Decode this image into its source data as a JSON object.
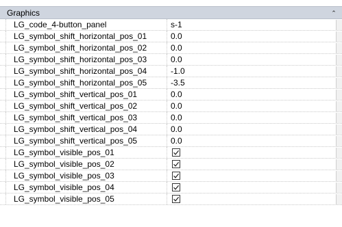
{
  "group": {
    "title": "Graphics",
    "collapse_icon": "double-chevron-up-icon",
    "collapse_glyph": "⌃"
  },
  "rows": [
    {
      "name": "LG_code_4-button_panel",
      "value": "s-1",
      "type": "text"
    },
    {
      "name": "LG_symbol_shift_horizontal_pos_01",
      "value": "0.0",
      "type": "text"
    },
    {
      "name": "LG_symbol_shift_horizontal_pos_02",
      "value": "0.0",
      "type": "text"
    },
    {
      "name": "LG_symbol_shift_horizontal_pos_03",
      "value": "0.0",
      "type": "text"
    },
    {
      "name": "LG_symbol_shift_horizontal_pos_04",
      "value": "-1.0",
      "type": "text"
    },
    {
      "name": "LG_symbol_shift_horizontal_pos_05",
      "value": "-3.5",
      "type": "text"
    },
    {
      "name": "LG_symbol_shift_vertical_pos_01",
      "value": "0.0",
      "type": "text"
    },
    {
      "name": "LG_symbol_shift_vertical_pos_02",
      "value": "0.0",
      "type": "text"
    },
    {
      "name": "LG_symbol_shift_vertical_pos_03",
      "value": "0.0",
      "type": "text"
    },
    {
      "name": "LG_symbol_shift_vertical_pos_04",
      "value": "0.0",
      "type": "text"
    },
    {
      "name": "LG_symbol_shift_vertical_pos_05",
      "value": "0.0",
      "type": "text"
    },
    {
      "name": "LG_symbol_visible_pos_01",
      "checked": true,
      "type": "checkbox"
    },
    {
      "name": "LG_symbol_visible_pos_02",
      "checked": true,
      "type": "checkbox"
    },
    {
      "name": "LG_symbol_visible_pos_03",
      "checked": true,
      "type": "checkbox"
    },
    {
      "name": "LG_symbol_visible_pos_04",
      "checked": true,
      "type": "checkbox"
    },
    {
      "name": "LG_symbol_visible_pos_05",
      "checked": true,
      "type": "checkbox"
    }
  ]
}
